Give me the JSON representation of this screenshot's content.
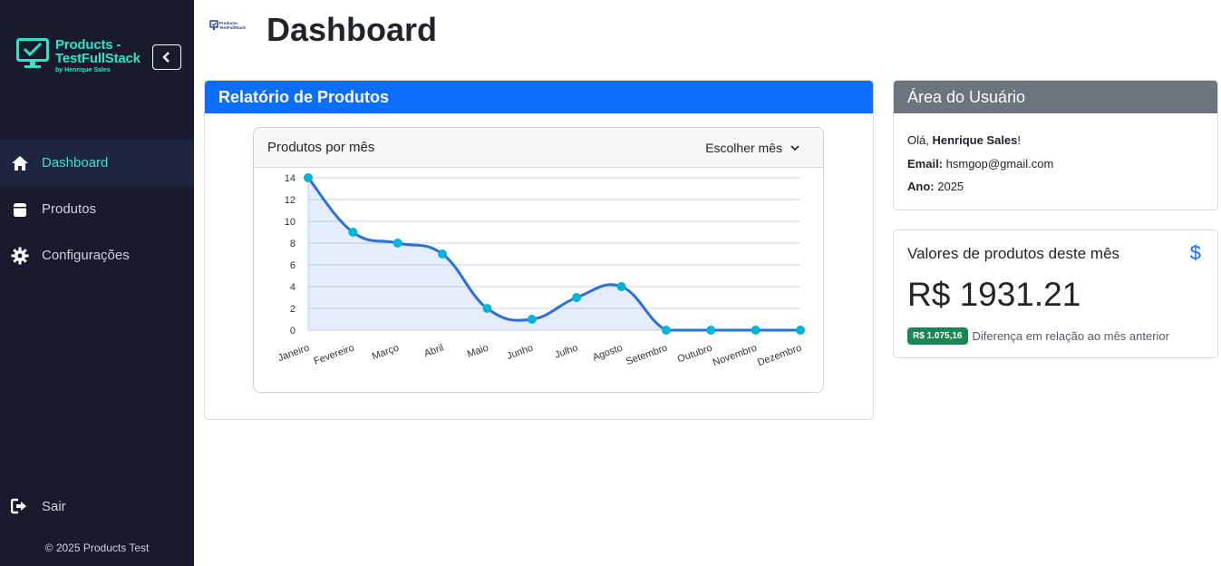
{
  "brand": {
    "title_line1": "Products -",
    "title_line2": "TestFullStack",
    "subtitle": "by Henrique Sales"
  },
  "sidebar": {
    "items": [
      {
        "label": "Dashboard",
        "icon": "home-icon",
        "active": true
      },
      {
        "label": "Produtos",
        "icon": "box-icon",
        "active": false
      },
      {
        "label": "Configurações",
        "icon": "gear-icon",
        "active": false
      }
    ],
    "logout_label": "Sair",
    "copyright": "© 2025 Products Test"
  },
  "header": {
    "title": "Dashboard",
    "mini_logo_line1": "Products-",
    "mini_logo_line2": "TestFullStack"
  },
  "report": {
    "title": "Relatório de Produtos",
    "chart_title": "Produtos por mês",
    "month_select": "Escolher mês"
  },
  "user": {
    "title": "Área do Usuário",
    "greeting_prefix": "Olá, ",
    "name": "Henrique Sales",
    "greeting_suffix": "!",
    "email_label": "Email:",
    "email": "hsmgop@gmail.com",
    "year_label": "Ano:",
    "year": "2025"
  },
  "values": {
    "title": "Valores de produtos deste mês",
    "icon": "dollar-icon",
    "amount": "R$ 1931.21",
    "badge": "R$ 1.075,16",
    "difference_text": "Diferença em relação ao mês anterior"
  },
  "colors": {
    "accent": "#2ee6c5",
    "primary": "#0d6efd",
    "sidebar_bg": "#181b2e",
    "line": "#2a6fdb",
    "point": "#00b4d8",
    "badge": "#198754"
  },
  "chart_data": {
    "type": "line",
    "title": "",
    "xlabel": "",
    "ylabel": "",
    "categories": [
      "Janeiro",
      "Fevereiro",
      "Março",
      "Abril",
      "Maio",
      "Junho",
      "Julho",
      "Agosto",
      "Setembro",
      "Outubro",
      "Novembro",
      "Dezembro"
    ],
    "series": [
      {
        "values": [
          14,
          9,
          8,
          7,
          2,
          1,
          3,
          4,
          0,
          0,
          0,
          0
        ]
      }
    ],
    "ylim": [
      0,
      14
    ],
    "yticks": [
      0,
      2,
      4,
      6,
      8,
      10,
      12,
      14
    ],
    "grid": true,
    "filled": true
  }
}
